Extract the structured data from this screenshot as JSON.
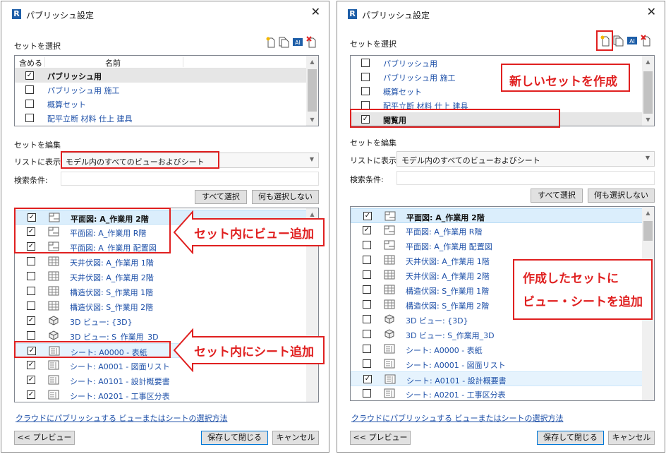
{
  "left": {
    "title": "パブリッシュ設定",
    "select_set_label": "セットを選択",
    "set_columns": {
      "include": "含める",
      "name": "名前"
    },
    "sets": [
      {
        "name": "パブリッシュ用",
        "checked": true,
        "selected": true
      },
      {
        "name": "パブリッシュ用 施工",
        "checked": false
      },
      {
        "name": "概算セット",
        "checked": false
      },
      {
        "name": "配平立断 材料 仕上 建具",
        "checked": false
      }
    ],
    "edit_set_label": "セットを編集",
    "show_in_list_label": "リストに表示:",
    "show_in_list_value": "モデル内のすべてのビューおよびシート",
    "search_label": "検索条件:",
    "search_value": "",
    "select_all": "すべて選択",
    "select_none": "何も選択しない",
    "views": [
      {
        "name": "平面図: A_作業用 2階",
        "checked": true,
        "icon": "floor-plan-icon",
        "bold": true,
        "hl": "hl"
      },
      {
        "name": "平面図: A_作業用 R階",
        "checked": true,
        "icon": "floor-plan-icon"
      },
      {
        "name": "平面図: A_作業用 配置図",
        "checked": true,
        "icon": "floor-plan-icon"
      },
      {
        "name": "天井伏図: A_作業用 1階",
        "checked": false,
        "icon": "ceiling-plan-icon"
      },
      {
        "name": "天井伏図: A_作業用 2階",
        "checked": false,
        "icon": "ceiling-plan-icon"
      },
      {
        "name": "構造伏図: S_作業用 1階",
        "checked": false,
        "icon": "ceiling-plan-icon"
      },
      {
        "name": "構造伏図: S_作業用 2階",
        "checked": false,
        "icon": "ceiling-plan-icon"
      },
      {
        "name": "3D ビュー: {3D}",
        "checked": true,
        "icon": "3d-view-icon"
      },
      {
        "name": "3D ビュー: S_作業用_3D",
        "checked": false,
        "icon": "3d-view-icon"
      },
      {
        "name": "シート: A0000 - 表紙",
        "checked": true,
        "icon": "sheet-icon",
        "hl": "hl2"
      },
      {
        "name": "シート: A0001 - 図面リスト",
        "checked": true,
        "icon": "sheet-icon"
      },
      {
        "name": "シート: A0101 - 設計概要書",
        "checked": true,
        "icon": "sheet-icon"
      },
      {
        "name": "シート: A0201 - 工事区分表",
        "checked": true,
        "icon": "sheet-icon"
      }
    ],
    "help_link": "クラウドにパブリッシュする ビューまたはシートの選択方法",
    "preview_button": "<< プレビュー",
    "save_close_button": "保存して閉じる",
    "cancel_button": "キャンセル",
    "callout_views": "セット内にビュー追加",
    "callout_sheets": "セット内にシート追加"
  },
  "right": {
    "title": "パブリッシュ設定",
    "select_set_label": "セットを選択",
    "sets": [
      {
        "name": "パブリッシュ用",
        "checked": false
      },
      {
        "name": "パブリッシュ用 施工",
        "checked": false
      },
      {
        "name": "概算セット",
        "checked": false
      },
      {
        "name": "配平立断 材料 仕上 建具",
        "checked": false
      },
      {
        "name": "閲覧用",
        "checked": true,
        "selected": true
      }
    ],
    "edit_set_label": "セットを編集",
    "show_in_list_label": "リストに表示:",
    "show_in_list_value": "モデル内のすべてのビューおよびシート",
    "search_label": "検索条件:",
    "search_value": "",
    "select_all": "すべて選択",
    "select_none": "何も選択しない",
    "views": [
      {
        "name": "平面図: A_作業用 2階",
        "checked": true,
        "icon": "floor-plan-icon",
        "bold": true,
        "hl": "hl"
      },
      {
        "name": "平面図: A_作業用 R階",
        "checked": true,
        "icon": "floor-plan-icon"
      },
      {
        "name": "平面図: A_作業用 配置図",
        "checked": false,
        "icon": "floor-plan-icon"
      },
      {
        "name": "天井伏図: A_作業用 1階",
        "checked": false,
        "icon": "ceiling-plan-icon"
      },
      {
        "name": "天井伏図: A_作業用 2階",
        "checked": false,
        "icon": "ceiling-plan-icon"
      },
      {
        "name": "構造伏図: S_作業用 1階",
        "checked": false,
        "icon": "ceiling-plan-icon"
      },
      {
        "name": "構造伏図: S_作業用 2階",
        "checked": false,
        "icon": "ceiling-plan-icon"
      },
      {
        "name": "3D ビュー: {3D}",
        "checked": false,
        "icon": "3d-view-icon"
      },
      {
        "name": "3D ビュー: S_作業用_3D",
        "checked": false,
        "icon": "3d-view-icon"
      },
      {
        "name": "シート: A0000 - 表紙",
        "checked": false,
        "icon": "sheet-icon"
      },
      {
        "name": "シート: A0001 - 図面リスト",
        "checked": false,
        "icon": "sheet-icon"
      },
      {
        "name": "シート: A0101 - 設計概要書",
        "checked": true,
        "icon": "sheet-icon",
        "hl": "hl2"
      },
      {
        "name": "シート: A0201 - 工事区分表",
        "checked": false,
        "icon": "sheet-icon"
      }
    ],
    "help_link": "クラウドにパブリッシュする ビューまたはシートの選択方法",
    "preview_button": "<< プレビュー",
    "save_close_button": "保存して閉じる",
    "cancel_button": "キャンセル",
    "callout_new_set": "新しいセットを作成",
    "callout_add_line1": "作成したセットに",
    "callout_add_line2": "ビュー・シートを追加"
  },
  "colors": {
    "annotation_red": "#e02020",
    "link_blue": "#1e50a8",
    "highlight": "#dbeefc"
  }
}
